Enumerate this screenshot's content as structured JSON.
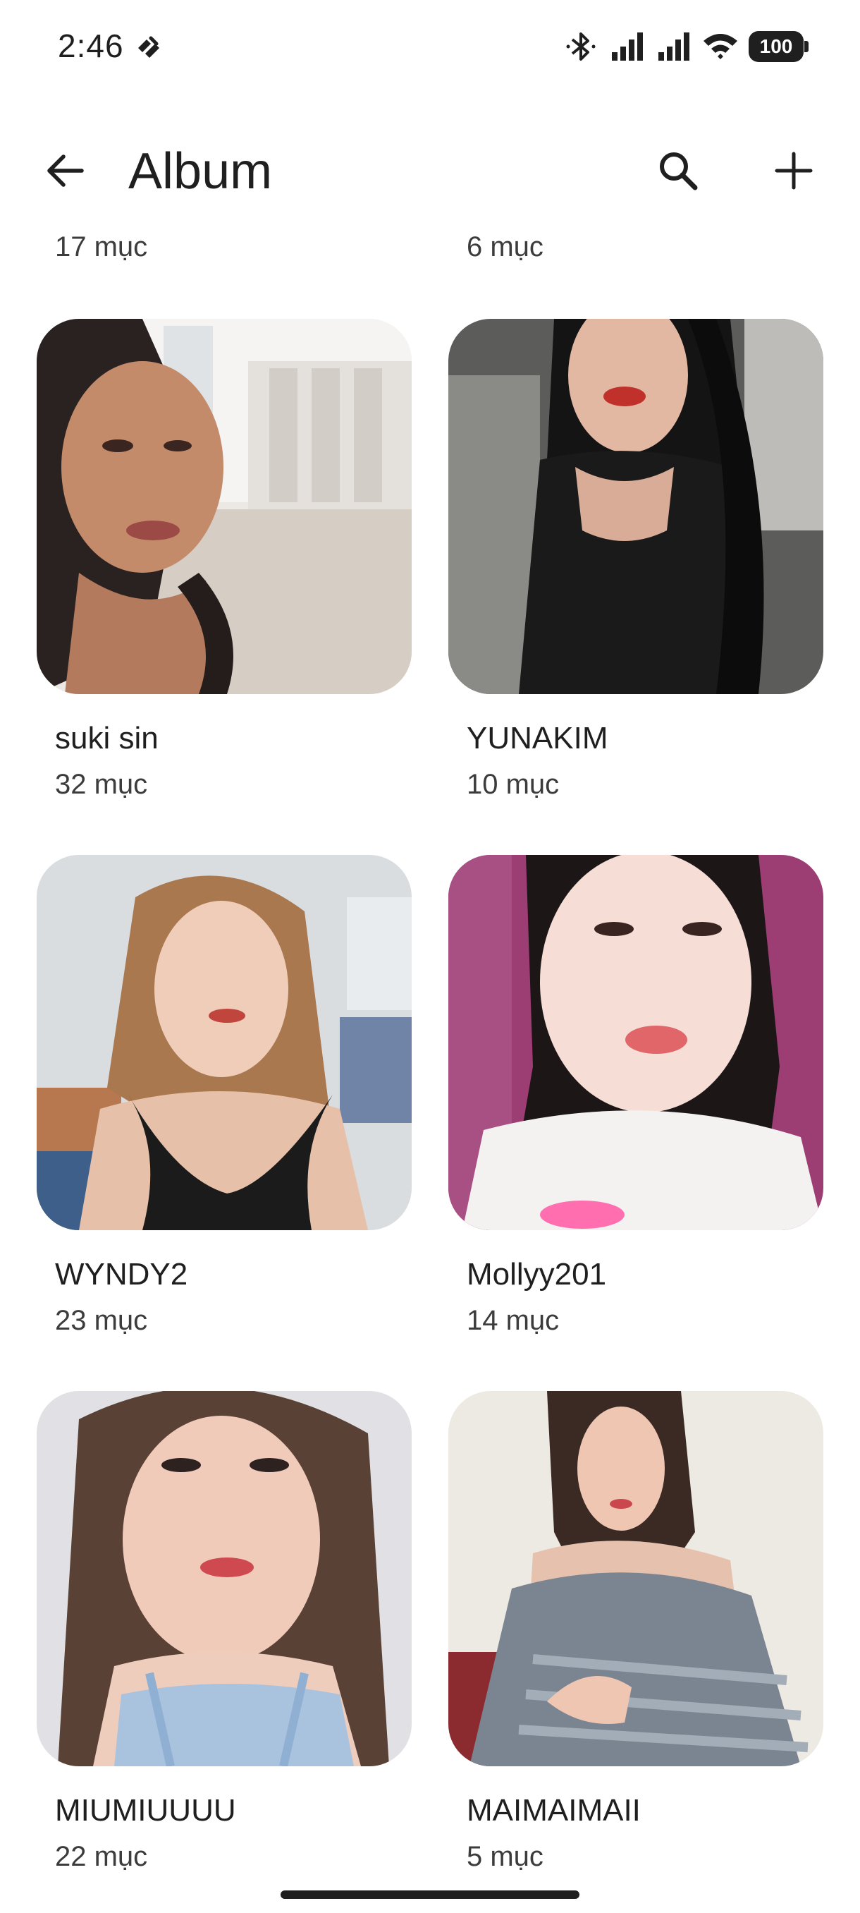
{
  "status_bar": {
    "time": "2:46",
    "left_icon": "notification-app-icon",
    "icons": [
      "bluetooth-icon",
      "signal-icon",
      "signal-icon",
      "wifi-icon"
    ],
    "battery": "100"
  },
  "app_bar": {
    "title": "Album",
    "back_icon": "arrow-back-icon",
    "search_icon": "search-icon",
    "add_icon": "add-icon"
  },
  "clipped_row": {
    "left_count": "17 mục",
    "right_count": "6 mục"
  },
  "albums": [
    {
      "name": "suki sin",
      "count": "32 mục"
    },
    {
      "name": "YUNAKIM",
      "count": "10 mục"
    },
    {
      "name": "WYNDY2",
      "count": "23 mục"
    },
    {
      "name": "Mollyy201",
      "count": "14 mục"
    },
    {
      "name": "MIUMIUUUU",
      "count": "22 mục"
    },
    {
      "name": "MAIMAIMAII",
      "count": "5 mục"
    }
  ],
  "colors": {
    "background": "#ffffff",
    "text_primary": "#1f1f1f",
    "text_secondary": "#3c3c3c"
  }
}
